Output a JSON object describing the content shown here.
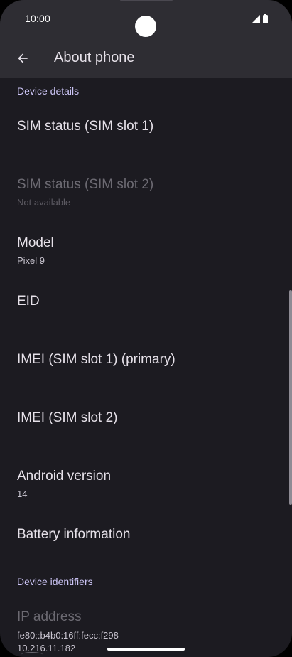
{
  "status_bar": {
    "time": "10:00"
  },
  "app_bar": {
    "title": "About phone",
    "back_icon": "arrow-back-icon"
  },
  "sections": {
    "device_details": "Device details",
    "device_identifiers": "Device identifiers"
  },
  "items": [
    {
      "title": "SIM status (SIM slot 1)",
      "summary": ""
    },
    {
      "title": "SIM status (SIM slot 2)",
      "summary": "Not available",
      "disabled": true
    },
    {
      "title": "Model",
      "summary": "Pixel 9"
    },
    {
      "title": "EID",
      "summary": ""
    },
    {
      "title": "IMEI (SIM slot 1) (primary)",
      "summary": ""
    },
    {
      "title": "IMEI (SIM slot 2)",
      "summary": ""
    },
    {
      "title": "Android version",
      "summary": "14"
    },
    {
      "title": "Battery information",
      "summary": ""
    }
  ],
  "ip_address": {
    "title": "IP address",
    "line1": "fe80::b4b0:16ff:fecc:f298",
    "line2": "10.216.11.182"
  },
  "colors": {
    "background": "#1c1b21",
    "app_bar": "#2e2d33",
    "section_header": "#cbc4f5",
    "text_primary": "#e6e1e9",
    "text_disabled": "#6c6a72"
  }
}
